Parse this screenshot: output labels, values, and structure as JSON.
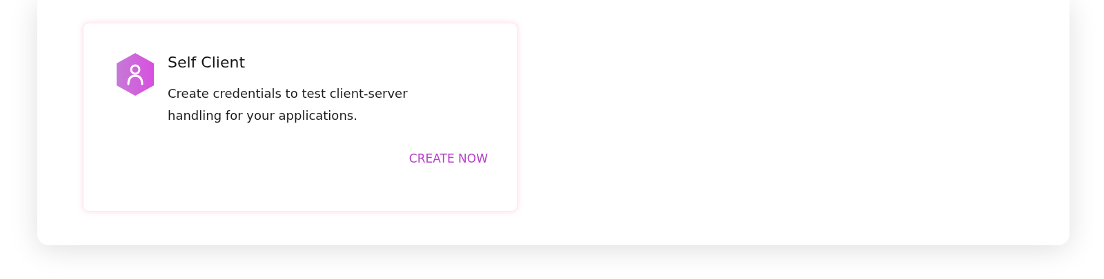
{
  "cards": [
    {
      "title": "Self Client",
      "description": "Create credentials to test client-server handling for your applications.",
      "action": "CREATE NOW"
    }
  ]
}
